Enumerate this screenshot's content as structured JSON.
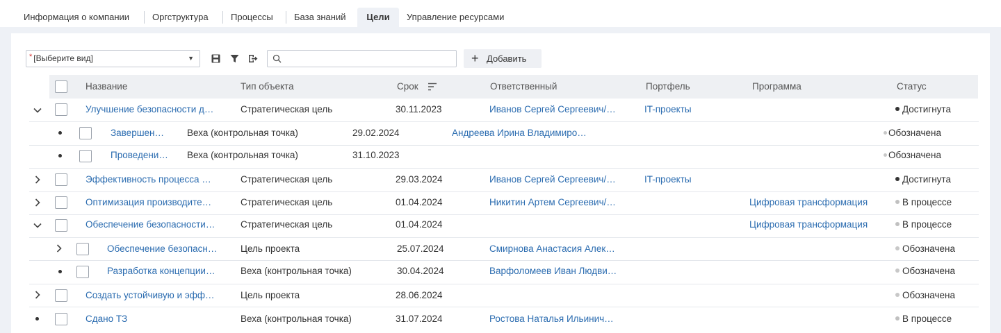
{
  "tabs": [
    {
      "label": "Информация о компании",
      "active": false
    },
    {
      "label": "Оргструктура",
      "active": false
    },
    {
      "label": "Процессы",
      "active": false
    },
    {
      "label": "База знаний",
      "active": false
    },
    {
      "label": "Цели",
      "active": true
    },
    {
      "label": "Управление ресурсами",
      "active": false
    }
  ],
  "toolbar": {
    "view_select_value": "[Выберите вид]",
    "required_mark": "*",
    "save_icon": "save-icon",
    "filter_icon": "filter-icon",
    "export_icon": "export-icon",
    "search_placeholder": "",
    "add_plus": "+",
    "add_label": "Добавить"
  },
  "table": {
    "headers": {
      "name": "Название",
      "type": "Тип объекта",
      "deadline": "Срок",
      "responsible": "Ответственный",
      "portfolio": "Портфель",
      "program": "Программа",
      "status": "Статус"
    },
    "rows": [
      {
        "name": "Улучшение безопасности д…",
        "type": "Стратегическая цель",
        "deadline": "30.11.2023",
        "responsible": "Иванов Сергей Сергеевич/…",
        "portfolio": "IT-проекты",
        "program": "",
        "status": "Достигнута"
      },
      {
        "name": "Завершен…",
        "type": "Веха (контрольная точка)",
        "deadline": "29.02.2024",
        "responsible": "Андреева Ирина Владимиро…",
        "portfolio": "",
        "program": "",
        "status": "Обозначена"
      },
      {
        "name": "Проведени…",
        "type": "Веха (контрольная точка)",
        "deadline": "31.10.2023",
        "responsible": "",
        "portfolio": "",
        "program": "",
        "status": "Обозначена"
      },
      {
        "name": "Эффективность процесса …",
        "type": "Стратегическая цель",
        "deadline": "29.03.2024",
        "responsible": "Иванов Сергей Сергеевич/…",
        "portfolio": "IT-проекты",
        "program": "",
        "status": "Достигнута"
      },
      {
        "name": "Оптимизация производите…",
        "type": "Стратегическая цель",
        "deadline": "01.04.2024",
        "responsible": "Никитин Артем Сергеевич/…",
        "portfolio": "",
        "program": "Цифровая трансформация",
        "status": "В процессе"
      },
      {
        "name": "Обеспечение безопасности…",
        "type": "Стратегическая цель",
        "deadline": "01.04.2024",
        "responsible": "",
        "portfolio": "",
        "program": "Цифровая трансформация",
        "status": "В процессе"
      },
      {
        "name": "Обеспечение безопасн…",
        "type": "Цель проекта",
        "deadline": "25.07.2024",
        "responsible": "Смирнова Анастасия Алек…",
        "portfolio": "",
        "program": "",
        "status": "Обозначена"
      },
      {
        "name": "Разработка концепции…",
        "type": "Веха (контрольная точка)",
        "deadline": "30.04.2024",
        "responsible": "Варфоломеев Иван Людви…",
        "portfolio": "",
        "program": "",
        "status": "Обозначена"
      },
      {
        "name": "Создать устойчивую и эфф…",
        "type": "Цель проекта",
        "deadline": "28.06.2024",
        "responsible": "",
        "portfolio": "",
        "program": "",
        "status": "Обозначена"
      },
      {
        "name": "Сдано ТЗ",
        "type": "Веха (контрольная точка)",
        "deadline": "31.07.2024",
        "responsible": "Ростова Наталья Ильинич…",
        "portfolio": "",
        "program": "",
        "status": "В процессе"
      }
    ]
  },
  "status_colors": {
    "Достигнута": "#333333",
    "Обозначена": "#c8c8c8",
    "В процессе": "#c0c0c0"
  }
}
